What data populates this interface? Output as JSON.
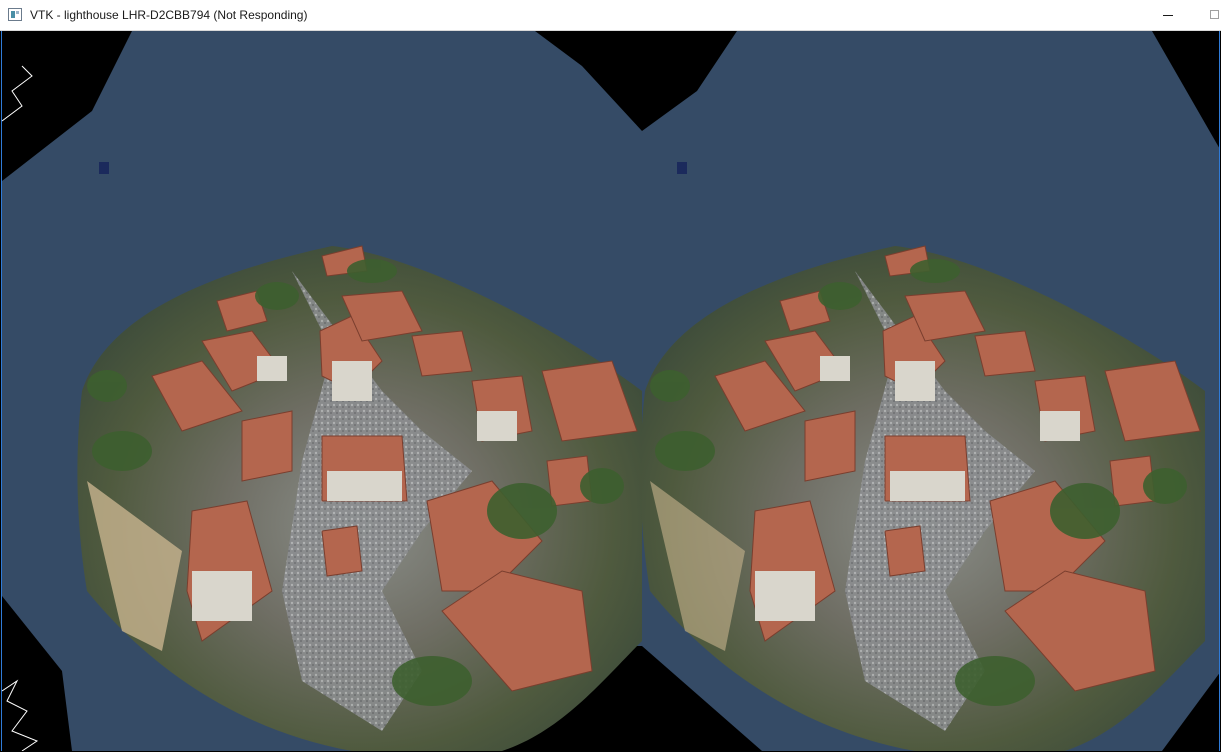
{
  "window": {
    "title": "VTK - lighthouse LHR-D2CBB794 (Not Responding)",
    "icon": "vtk-app-icon",
    "controls": {
      "minimize_icon": "minimize-icon",
      "maximize_icon": "maximize-icon"
    }
  },
  "render": {
    "background_color": "#354b66",
    "mask_color": "#000000",
    "views": [
      "left-eye",
      "right-eye"
    ]
  }
}
